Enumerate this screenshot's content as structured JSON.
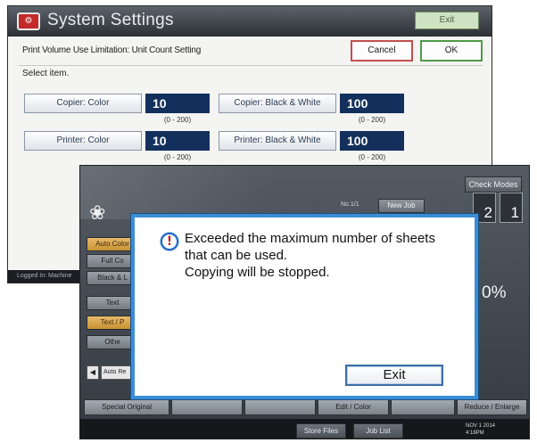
{
  "system_settings": {
    "logo": "⚙",
    "title": "System Settings",
    "exit_label": "Exit",
    "subtitle": "Print Volume Use Limitation: Unit Count Setting",
    "cancel_label": "Cancel",
    "ok_label": "OK",
    "select_prompt": "Select item.",
    "fields": [
      {
        "label": "Copier: Color",
        "value": "10",
        "range": "(0 - 200)"
      },
      {
        "label": "Copier: Black & White",
        "value": "100",
        "range": "(0 - 200)"
      },
      {
        "label": "Printer: Color",
        "value": "10",
        "range": "(0 - 200)"
      },
      {
        "label": "Printer: Black & White",
        "value": "100",
        "range": "(0 - 200)"
      }
    ],
    "footer_text": "Logged In: Machine"
  },
  "copy_screen": {
    "check_modes_label": "Check Modes",
    "small_text": "No.1/1",
    "new_job_label": "New Job",
    "counters": [
      {
        "value": "2"
      },
      {
        "value": "1"
      }
    ],
    "percent": "0%",
    "side_buttons": [
      "Auto Color",
      "Full Co",
      "Black & L",
      "Text",
      "Text / P",
      "Othe"
    ],
    "auto_reduce_label": "Auto Re",
    "bottom_buttons": [
      "Special Original",
      "Edit / Color",
      "Reduce / Enlarge"
    ],
    "status_buttons": [
      "Store Files",
      "Job List"
    ],
    "status_time": [
      "NOV 1 2014",
      "4:18PM"
    ]
  },
  "dialog": {
    "icon": "!",
    "message_lines": [
      "Exceeded the maximum number of sheets",
      "that can be used.",
      "Copying will be stopped."
    ],
    "exit_label": "Exit"
  },
  "colors": {
    "dialog_border": "#3a8dd6",
    "field_value_bg": "#13305c",
    "cancel_border": "#c44f4f",
    "ok_border": "#4f9a4a",
    "orange_button": "#d8a14a"
  }
}
